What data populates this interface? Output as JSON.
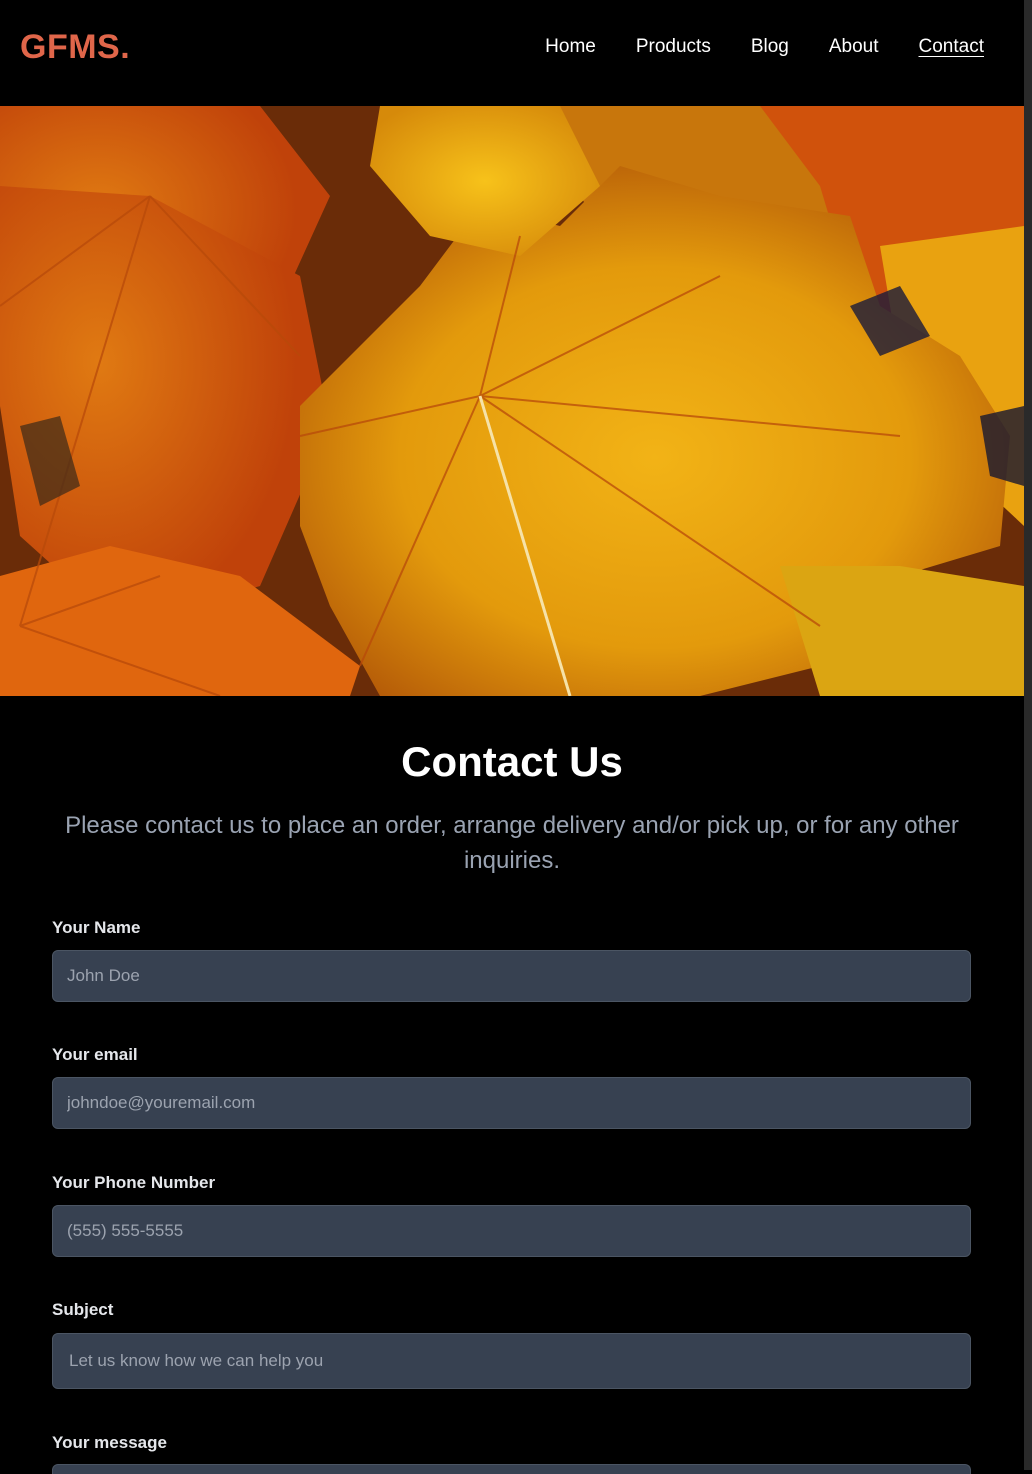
{
  "brand": {
    "logo": "GFMS."
  },
  "nav": {
    "items": [
      {
        "label": "Home"
      },
      {
        "label": "Products"
      },
      {
        "label": "Blog"
      },
      {
        "label": "About"
      },
      {
        "label": "Contact",
        "active": true
      }
    ]
  },
  "hero": {
    "image_subject": "autumn maple leaves"
  },
  "contact": {
    "title": "Contact Us",
    "intro": "Please contact us to place an order, arrange delivery and/or pick up, or for any other inquiries.",
    "fields": {
      "name": {
        "label": "Your Name",
        "placeholder": "John Doe"
      },
      "email": {
        "label": "Your email",
        "placeholder": "johndoe@youremail.com"
      },
      "phone": {
        "label": "Your Phone Number",
        "placeholder": "(555) 555-5555"
      },
      "subject": {
        "label": "Subject",
        "placeholder": "Let us know how we can help you"
      },
      "message": {
        "label": "Your message"
      }
    }
  },
  "colors": {
    "background": "#000000",
    "brand": "#e0664a",
    "input_bg": "#374151",
    "muted_text": "#9aa3b2"
  }
}
